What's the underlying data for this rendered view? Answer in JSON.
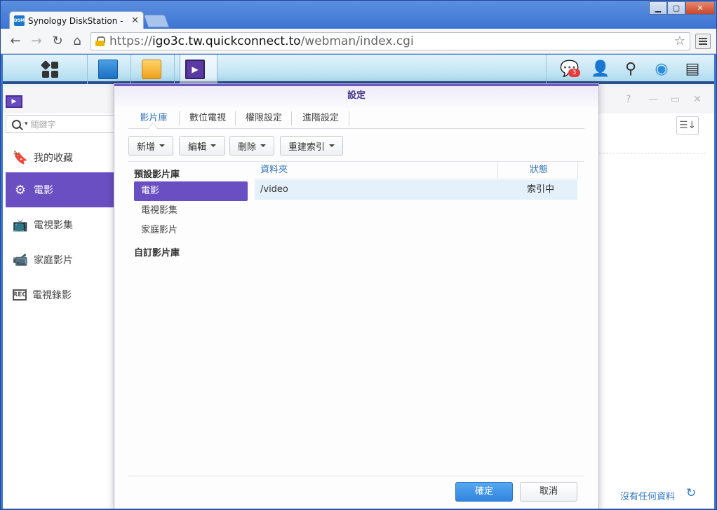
{
  "browser": {
    "tab_title": "Synology DiskStation - [",
    "favicon_text": "DSM",
    "url_scheme": "https://",
    "url_host": "igo3c.tw.quickconnect.to",
    "url_path": "/webman/index.cgi"
  },
  "taskbar": {
    "notification_count": "3"
  },
  "app": {
    "search_placeholder": "關鍵字",
    "sidebar": [
      {
        "label": "我的收藏",
        "icon": "bookmark-icon"
      },
      {
        "label": "電影",
        "icon": "film-reel-icon"
      },
      {
        "label": "電視影集",
        "icon": "tv-icon"
      },
      {
        "label": "家庭影片",
        "icon": "camcorder-icon"
      },
      {
        "label": "電視錄影",
        "icon": "rec-tv-icon"
      }
    ],
    "no_data": "沒有任何資料"
  },
  "dialog": {
    "title": "設定",
    "tabs": [
      "影片庫",
      "數位電視",
      "權限設定",
      "進階設定"
    ],
    "buttons": [
      "新增",
      "編輯",
      "刪除",
      "重建索引"
    ],
    "default_libraries_heading": "預設影片庫",
    "default_libraries": [
      "電影",
      "電視影集",
      "家庭影片"
    ],
    "custom_libraries_heading": "自訂影片庫",
    "table": {
      "columns": [
        "資料夾",
        "狀態"
      ],
      "rows": [
        {
          "folder": "/video",
          "status": "索引中"
        }
      ]
    },
    "ok_label": "確定",
    "cancel_label": "取消"
  }
}
